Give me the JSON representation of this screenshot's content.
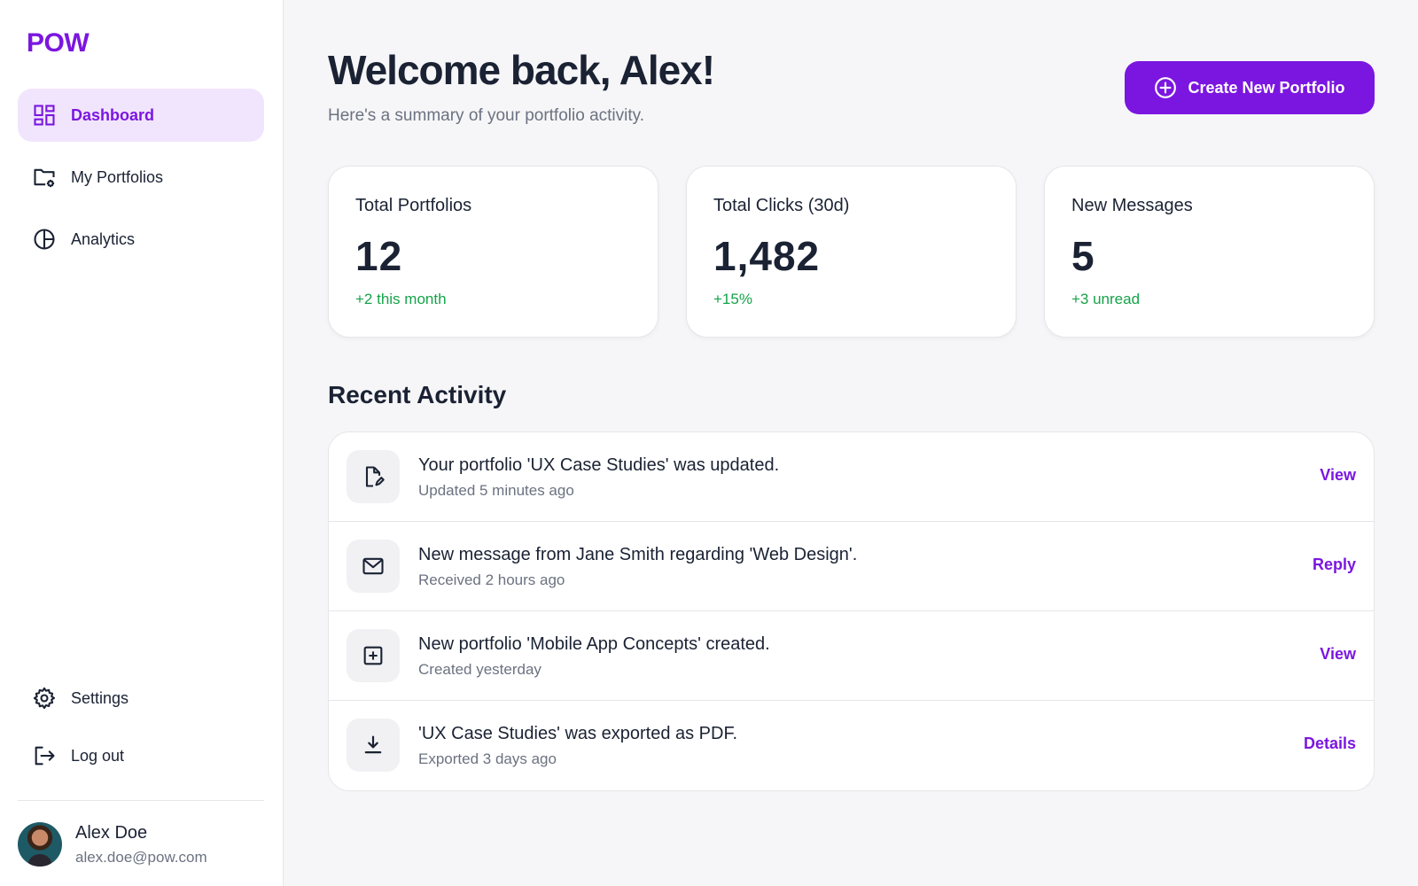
{
  "app": {
    "logo": "POW"
  },
  "sidebar": {
    "nav": [
      {
        "label": "Dashboard",
        "icon": "dashboard-icon",
        "active": true
      },
      {
        "label": "My Portfolios",
        "icon": "folder-settings-icon",
        "active": false
      },
      {
        "label": "Analytics",
        "icon": "pie-chart-icon",
        "active": false
      }
    ],
    "bottom": [
      {
        "label": "Settings",
        "icon": "gear-icon"
      },
      {
        "label": "Log out",
        "icon": "logout-icon"
      }
    ],
    "user": {
      "name": "Alex Doe",
      "email": "alex.doe@pow.com"
    }
  },
  "header": {
    "title": "Welcome back, Alex!",
    "subtitle": "Here's a summary of your portfolio activity.",
    "create_button": "Create New Portfolio"
  },
  "stats": [
    {
      "label": "Total Portfolios",
      "value": "12",
      "change": "+2 this month"
    },
    {
      "label": "Total Clicks (30d)",
      "value": "1,482",
      "change": "+15%"
    },
    {
      "label": "New Messages",
      "value": "5",
      "change": "+3 unread"
    }
  ],
  "recent_activity": {
    "title": "Recent Activity",
    "items": [
      {
        "icon": "file-edit-icon",
        "title": "Your portfolio 'UX Case Studies' was updated.",
        "subtitle": "Updated 5 minutes ago",
        "action": "View"
      },
      {
        "icon": "mail-icon",
        "title": "New message from Jane Smith regarding 'Web Design'.",
        "subtitle": "Received 2 hours ago",
        "action": "Reply"
      },
      {
        "icon": "add-box-icon",
        "title": "New portfolio 'Mobile App Concepts' created.",
        "subtitle": "Created yesterday",
        "action": "View"
      },
      {
        "icon": "download-icon",
        "title": "'UX Case Studies' was exported as PDF.",
        "subtitle": "Exported 3 days ago",
        "action": "Details"
      }
    ]
  },
  "colors": {
    "accent": "#7b16e0",
    "accent_light": "#f1e5fd",
    "positive": "#16a34a",
    "background": "#f6f6f8"
  }
}
